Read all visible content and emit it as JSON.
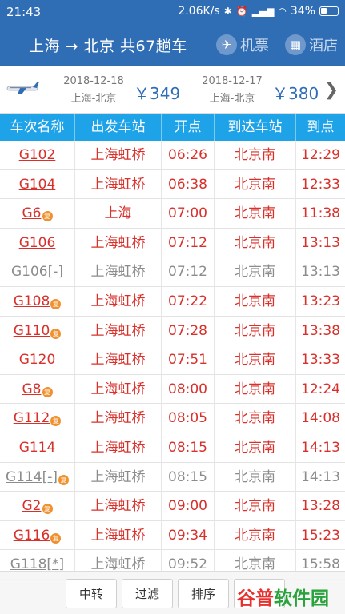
{
  "status_bar": {
    "time": "21:43",
    "speed": "2.06K/s",
    "battery": "34%"
  },
  "header": {
    "title": "上海 → 北京 共67趟车",
    "flight_label": "机票",
    "hotel_label": "酒店"
  },
  "alternatives": [
    {
      "date": "2018-12-18",
      "route": "上海-北京",
      "price": "￥349"
    },
    {
      "date": "2018-12-17",
      "route": "上海-北京",
      "price": "￥380"
    }
  ],
  "table": {
    "headers": [
      "车次名称",
      "出发车站",
      "开点",
      "到达车站",
      "到点"
    ],
    "rows": [
      {
        "train": "G102",
        "from": "上海虹桥",
        "depart": "06:26",
        "to": "北京南",
        "arrive": "12:29",
        "available": true,
        "badge": ""
      },
      {
        "train": "G104",
        "from": "上海虹桥",
        "depart": "06:38",
        "to": "北京南",
        "arrive": "12:33",
        "available": true,
        "badge": ""
      },
      {
        "train": "G6",
        "from": "上海",
        "depart": "07:00",
        "to": "北京南",
        "arrive": "11:38",
        "available": true,
        "badge": "复"
      },
      {
        "train": "G106",
        "from": "上海虹桥",
        "depart": "07:12",
        "to": "北京南",
        "arrive": "13:13",
        "available": true,
        "badge": ""
      },
      {
        "train": "G106[-]",
        "from": "上海虹桥",
        "depart": "07:12",
        "to": "北京南",
        "arrive": "13:13",
        "available": false,
        "badge": ""
      },
      {
        "train": "G108",
        "from": "上海虹桥",
        "depart": "07:22",
        "to": "北京南",
        "arrive": "13:23",
        "available": true,
        "badge": "复"
      },
      {
        "train": "G110",
        "from": "上海虹桥",
        "depart": "07:28",
        "to": "北京南",
        "arrive": "13:38",
        "available": true,
        "badge": "复"
      },
      {
        "train": "G120",
        "from": "上海虹桥",
        "depart": "07:51",
        "to": "北京南",
        "arrive": "13:33",
        "available": true,
        "badge": ""
      },
      {
        "train": "G8",
        "from": "上海虹桥",
        "depart": "08:00",
        "to": "北京南",
        "arrive": "12:24",
        "available": true,
        "badge": "复"
      },
      {
        "train": "G112",
        "from": "上海虹桥",
        "depart": "08:05",
        "to": "北京南",
        "arrive": "14:08",
        "available": true,
        "badge": "复"
      },
      {
        "train": "G114",
        "from": "上海虹桥",
        "depart": "08:15",
        "to": "北京南",
        "arrive": "14:13",
        "available": true,
        "badge": ""
      },
      {
        "train": "G114[-]",
        "from": "上海虹桥",
        "depart": "08:15",
        "to": "北京南",
        "arrive": "14:13",
        "available": false,
        "badge": "复"
      },
      {
        "train": "G2",
        "from": "上海虹桥",
        "depart": "09:00",
        "to": "北京南",
        "arrive": "13:28",
        "available": true,
        "badge": "复"
      },
      {
        "train": "G116",
        "from": "上海虹桥",
        "depart": "09:34",
        "to": "北京南",
        "arrive": "15:23",
        "available": true,
        "badge": "复"
      },
      {
        "train": "G118[*]",
        "from": "上海虹桥",
        "depart": "09:52",
        "to": "北京南",
        "arrive": "15:58",
        "available": false,
        "badge": ""
      }
    ]
  },
  "bottom_bar": {
    "transfer": "中转",
    "filter": "过滤",
    "sort": "排序",
    "watermark_a": "谷普",
    "watermark_b": "软件园"
  },
  "colors": {
    "primary": "#2f6db5",
    "table_header": "#1fa3e8",
    "available": "#d8302b",
    "unavailable": "#8c8c8c",
    "badge": "#f0912f"
  }
}
